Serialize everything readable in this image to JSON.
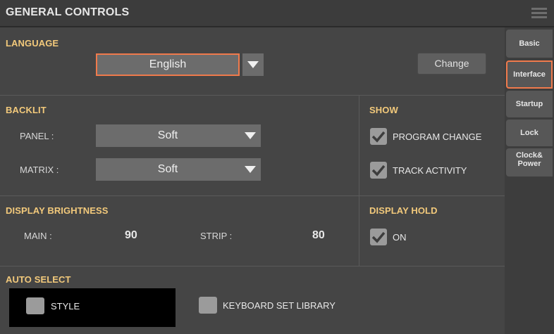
{
  "header": {
    "title": "GENERAL CONTROLS",
    "menu_icon": "hamburger-menu-icon"
  },
  "language": {
    "section_label": "LANGUAGE",
    "value": "English",
    "change_button": "Change"
  },
  "backlit": {
    "section_label": "BACKLIT",
    "panel_label": "PANEL :",
    "panel_value": "Soft",
    "matrix_label": "MATRIX :",
    "matrix_value": "Soft"
  },
  "show": {
    "section_label": "SHOW",
    "program_change": "PROGRAM CHANGE",
    "track_activity": "TRACK ACTIVITY"
  },
  "brightness": {
    "section_label": "DISPLAY BRIGHTNESS",
    "main_label": "MAIN :",
    "main_value": "90",
    "strip_label": "STRIP :",
    "strip_value": "80"
  },
  "display_hold": {
    "section_label": "DISPLAY HOLD",
    "on_label": "ON"
  },
  "auto_select": {
    "section_label": "AUTO SELECT",
    "style_label": "STYLE",
    "keyboard_set_label": "KEYBOARD SET LIBRARY"
  },
  "tabs": {
    "basic": "Basic",
    "interface": "Interface",
    "startup": "Startup",
    "lock": "Lock",
    "clock_line1": "Clock&",
    "clock_line2": "Power"
  },
  "colors": {
    "accent": "#f07a4c",
    "section_label": "#f2c97b"
  }
}
